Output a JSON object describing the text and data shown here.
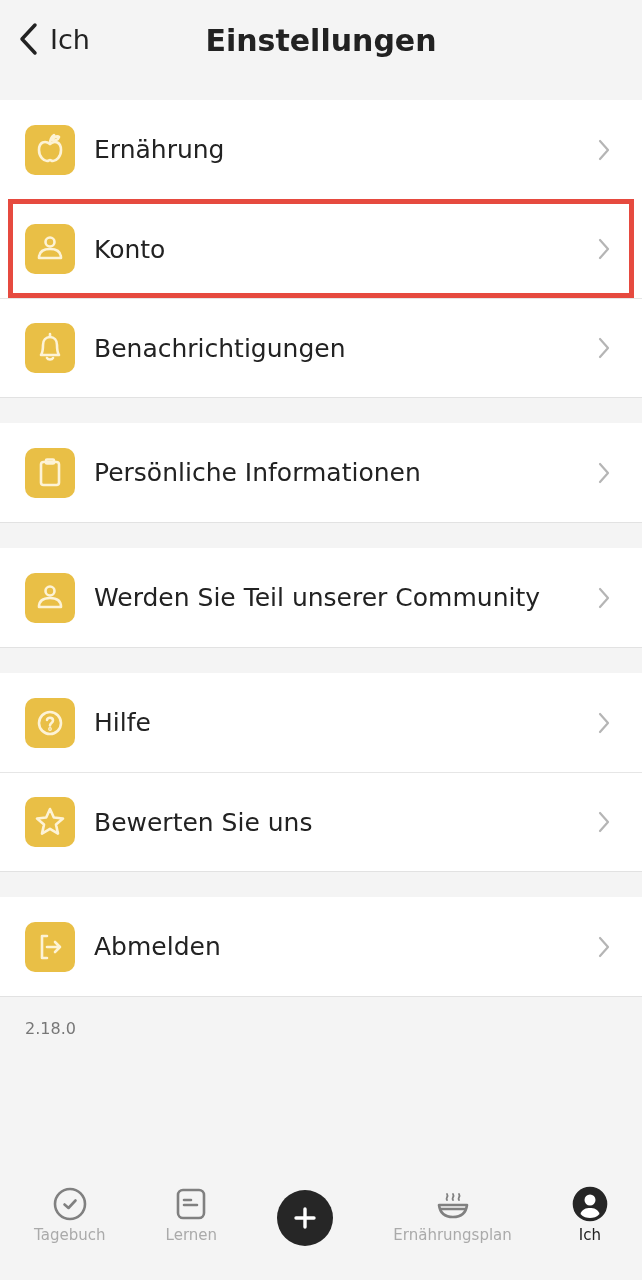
{
  "header": {
    "back_label": "Ich",
    "title": "Einstellungen"
  },
  "groups": [
    {
      "items": [
        {
          "label": "Ernährung",
          "highlighted": false
        },
        {
          "label": "Konto",
          "highlighted": true
        },
        {
          "label": "Benachrichtigungen",
          "highlighted": false
        }
      ]
    },
    {
      "items": [
        {
          "label": "Persönliche Informationen",
          "highlighted": false
        }
      ]
    },
    {
      "items": [
        {
          "label": "Werden Sie Teil unserer Community",
          "highlighted": false
        }
      ]
    },
    {
      "items": [
        {
          "label": "Hilfe",
          "highlighted": false
        },
        {
          "label": "Bewerten Sie uns",
          "highlighted": false
        }
      ]
    },
    {
      "items": [
        {
          "label": "Abmelden",
          "highlighted": false
        }
      ]
    }
  ],
  "version": "2.18.0",
  "tab_bar": [
    {
      "kind": "tab",
      "label": "Tagebuch",
      "selected": false
    },
    {
      "kind": "tab",
      "label": "Lernen",
      "selected": false
    },
    {
      "kind": "add"
    },
    {
      "kind": "tab",
      "label": "Ernährungsplan",
      "selected": false
    },
    {
      "kind": "tab",
      "label": "Ich",
      "selected": true
    }
  ]
}
